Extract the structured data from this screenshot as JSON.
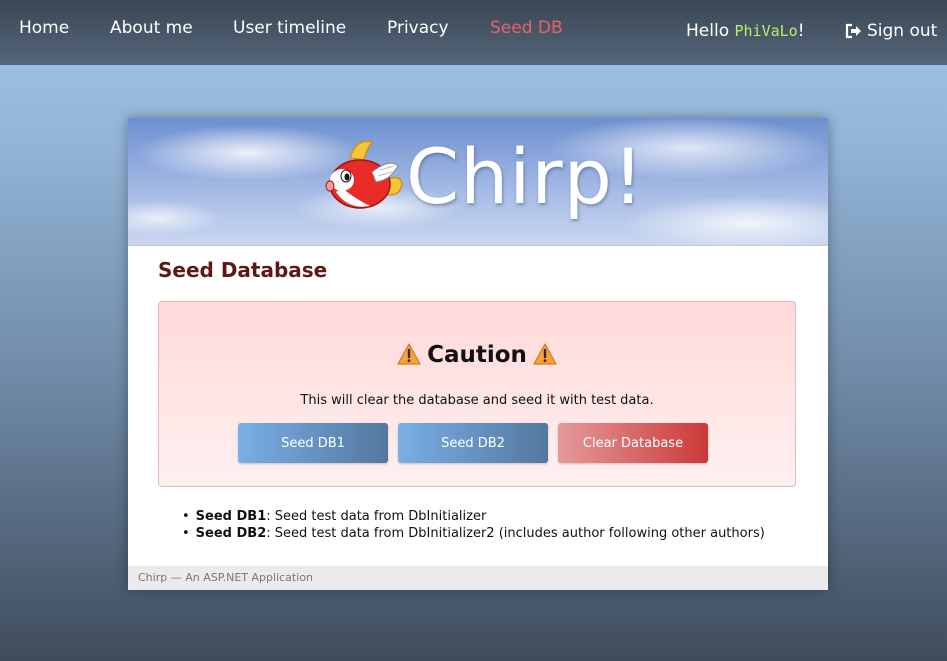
{
  "nav": {
    "home": "Home",
    "about": "About me",
    "timeline": "User timeline",
    "privacy": "Privacy",
    "seed": "Seed DB",
    "greeting_prefix": "Hello ",
    "username": "PhiVaLo",
    "greeting_suffix": "!",
    "signout": "Sign out",
    "active_color": "#e8616b",
    "username_color": "#b9ee6b"
  },
  "banner": {
    "title": "Chirp!",
    "logo_icon": "flying-fish-icon"
  },
  "page": {
    "title": "Seed Database"
  },
  "alert": {
    "heading": "Caution",
    "icon": "warning-icon",
    "message": "This will clear the database and seed it with test data.",
    "buttons": {
      "seed1": "Seed DB1",
      "seed2": "Seed DB2",
      "clear": "Clear Database"
    }
  },
  "notes": [
    {
      "name": "Seed DB1",
      "text": ": Seed test data from DbInitializer"
    },
    {
      "name": "Seed DB2",
      "text": ": Seed test data from DbInitializer2 (includes author following other authors)"
    }
  ],
  "footer": {
    "text": "Chirp — An ASP.NET Application"
  }
}
